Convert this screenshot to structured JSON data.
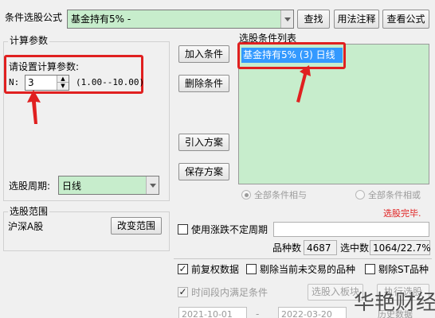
{
  "formula": {
    "label": "条件选股公式",
    "value": "基金持有5%  -",
    "find_btn": "查找",
    "usage_btn": "用法注释",
    "view_btn": "查看公式"
  },
  "params": {
    "group_title": "计算参数",
    "prompt": "请设置计算参数:",
    "n_label": "N:",
    "n_value": "3",
    "n_range": "(1.00--10.00)",
    "period_label": "选股周期:",
    "period_value": "日线"
  },
  "conditions": {
    "add_btn": "加入条件",
    "delete_btn": "删除条件",
    "import_btn": "引入方案",
    "save_btn": "保存方案",
    "list_title": "选股条件列表",
    "items": [
      "基金持有5% (3) 日线"
    ],
    "radio_and": "全部条件相与",
    "radio_or": "全部条件相或"
  },
  "range": {
    "group_title": "选股范围",
    "value": "沪深A股",
    "change_btn": "改变范围"
  },
  "status": {
    "done_text": "选股完毕.",
    "done_color": "#e02020",
    "uncertain_period": "使用涨跌不定周期",
    "count_label": "品种数",
    "count_value": "4687",
    "selected_label": "选中数",
    "selected_value": "1064/22.7%"
  },
  "options": {
    "prev_adjust": "前复权数据",
    "exclude_untraded": "剔除当前未交易的品种",
    "exclude_st": "剔除ST品种",
    "time_range": "时间段内满足条件",
    "to_block_btn": "选股入板块",
    "run_btn": "执行选股",
    "date_from": "2021-10-01",
    "date_to": "2022-03-20",
    "sub_text": "历史数据"
  },
  "watermark": "华艳财经",
  "colors": {
    "highlight": "#e02020",
    "list_bg": "#c7edcc",
    "selection": "#3399ff"
  }
}
